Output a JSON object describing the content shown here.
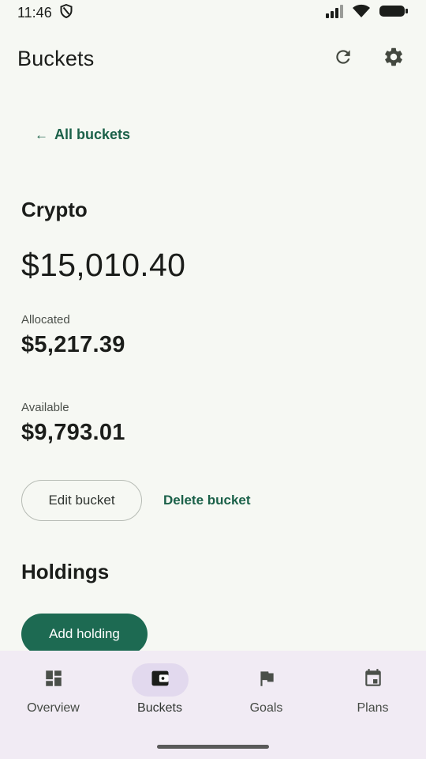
{
  "status_bar": {
    "time": "11:46"
  },
  "app_bar": {
    "title": "Buckets",
    "refresh_icon": "refresh-icon",
    "settings_icon": "gear-icon"
  },
  "back_link": {
    "label": "All buckets"
  },
  "bucket": {
    "name": "Crypto",
    "total": "$15,010.40",
    "allocated_label": "Allocated",
    "allocated_value": "$5,217.39",
    "available_label": "Available",
    "available_value": "$9,793.01"
  },
  "actions": {
    "edit_label": "Edit bucket",
    "delete_label": "Delete bucket"
  },
  "holdings": {
    "title": "Holdings",
    "add_label": "Add holding"
  },
  "nav": {
    "items": [
      {
        "label": "Overview",
        "icon": "dashboard-icon"
      },
      {
        "label": "Buckets",
        "icon": "wallet-icon",
        "active": true
      },
      {
        "label": "Goals",
        "icon": "flag-icon"
      },
      {
        "label": "Plans",
        "icon": "calendar-icon"
      }
    ]
  },
  "colors": {
    "accent": "#1d6a52",
    "link": "#1b6149",
    "background": "#f6f8f3",
    "nav_background": "#f1ebf4",
    "nav_active_pill": "#e2d9ee"
  }
}
